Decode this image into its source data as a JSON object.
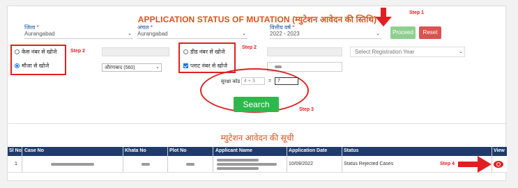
{
  "header": {
    "title": "APPLICATION STATUS OF MUTATION (म्युटेशन आवेदन की स्तिथि)"
  },
  "filters": {
    "district_label": "जिला",
    "district_value": "Aurangabad",
    "circle_label": "अंचल",
    "circle_value": "Aurangabad",
    "fy_label": "वित्तीय वर्ष",
    "fy_value": "2022 - 2023",
    "proceed_label": "Proceed",
    "reset_label": "Reset"
  },
  "search": {
    "case_no_radio": "केस नंबर से खोजे",
    "mauza_radio": "मौजा से खोजे",
    "deed_no_radio": "डीड नंबर से खोजे",
    "plot_no_check": "प्लाट नंबर से खोजे",
    "mauza_value": "औरंगाबाद (560)",
    "reg_year_placeholder": "Select Registration Year",
    "plot_value": "",
    "captcha_label": "सुरक्षा कोड :",
    "captcha_question": "4 + 3",
    "captcha_equals": "=",
    "captcha_answer": "7",
    "search_button": "Search"
  },
  "steps": {
    "step1": "Step 1",
    "step2a": "Step 2",
    "step2b": "Step 2",
    "step3": "Step 3",
    "step4": "Step 4"
  },
  "results": {
    "list_title": "म्युटेशन आवेदन की सूची",
    "columns": [
      "Sl No",
      "Case No",
      "Khata No",
      "Plot No",
      "Applicant Name",
      "Application Date",
      "Status",
      "View"
    ],
    "rows": [
      {
        "sl_no": "1",
        "application_date": "10/09/2022",
        "status": "Status Rejected Cases"
      }
    ]
  },
  "colors": {
    "accent_orange": "#d9531e",
    "header_blue": "#1e3b6b",
    "highlight_red": "#e02020",
    "search_green": "#2eb84b"
  },
  "icons": [
    "eye-icon",
    "arrow-down-icon",
    "arrow-right-icon",
    "chevron-down-icon"
  ]
}
